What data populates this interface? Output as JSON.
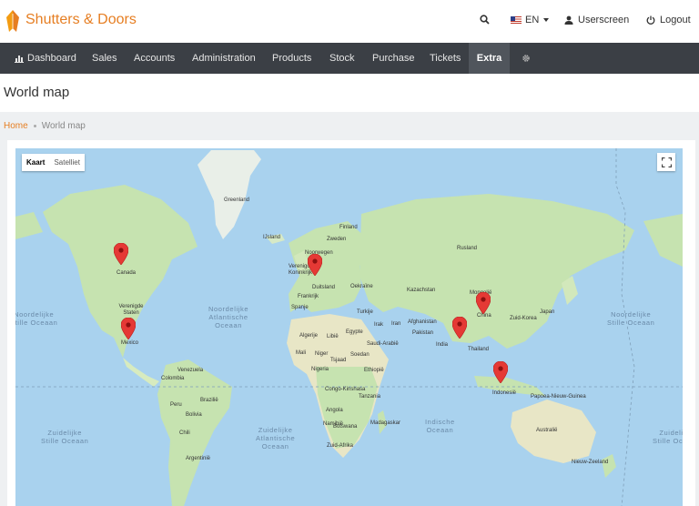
{
  "app": {
    "brand": "Shutters & Doors"
  },
  "header": {
    "language": "EN",
    "user_label": "Userscreen",
    "logout_label": "Logout"
  },
  "nav": {
    "dashboard": "Dashboard",
    "sales": "Sales",
    "accounts": "Accounts",
    "administration": "Administration",
    "products": "Products",
    "stock": "Stock",
    "purchase": "Purchase",
    "tickets": "Tickets",
    "extra": "Extra",
    "active": "Extra"
  },
  "page": {
    "title": "World map"
  },
  "breadcrumb": {
    "home": "Home",
    "current": "World map"
  },
  "map": {
    "type_map": "Kaart",
    "type_satellite": "Satelliet",
    "labels": {
      "greenland": "Greenland",
      "iceland": "IJsland",
      "finland": "Finland",
      "sweden": "Zweden",
      "norway": "Noorwegen",
      "russia": "Rusland",
      "canada": "Canada",
      "uk": "Verenigd Koninkrijk",
      "germany": "Duitsland",
      "france": "Frankrijk",
      "spain": "Spanje",
      "ukraine": "Oekraïne",
      "kazakhstan": "Kazachstan",
      "mongolia": "Mongolië",
      "china": "China",
      "south_korea": "Zuid-Korea",
      "japan": "Japan",
      "usa": "Verenigde Staten",
      "mexico": "Mexico",
      "turkey": "Turkije",
      "iraq": "Irak",
      "iran": "Iran",
      "afghanistan": "Afghanistan",
      "pakistan": "Pakistan",
      "india": "India",
      "thailand": "Thailand",
      "algeria": "Algerije",
      "libya": "Libië",
      "egypt": "Egypte",
      "saudi_arabia": "Saudi-Arabië",
      "mali": "Mali",
      "niger": "Niger",
      "chad": "Tsjaad",
      "sudan": "Soedan",
      "nigeria": "Nigeria",
      "ethiopia": "Ethiopië",
      "venezuela": "Venezuela",
      "colombia": "Colombia",
      "peru": "Peru",
      "brazil": "Brazilië",
      "bolivia": "Bolivia",
      "chile": "Chili",
      "argentina": "Argentinië",
      "congo": "Congo-Kinshasa",
      "tanzania": "Tanzania",
      "angola": "Angola",
      "namibia": "Namibië",
      "botswana": "Botswana",
      "madagascar": "Madagaskar",
      "south_africa": "Zuid-Afrika",
      "indonesia": "Indonesië",
      "papua": "Papoea-Nieuw-Guinea",
      "australia": "Australië",
      "new_zealand": "Nieuw-Zeeland"
    },
    "oceans": {
      "n_pacific_left": "Noordelijke\nStille Oceaan",
      "n_atlantic": "Noordelijke\nAtlantische\nOceaan",
      "n_pacific_right": "Noordelijke\nStille Oceaan",
      "s_pacific_left": "Zuidelijke\nStille Oceaan",
      "s_atlantic": "Zuidelijke\nAtlantische\nOceaan",
      "indian": "Indische\nOceaan",
      "s_pacific_right": "Zuidelijke\nStille Oceaan"
    },
    "marker_color": "#e53935"
  },
  "colors": {
    "brand": "#e67e22",
    "navbar": "#3b3f45",
    "ocean": "#a9d2ee",
    "land": "#c6e3b0"
  }
}
